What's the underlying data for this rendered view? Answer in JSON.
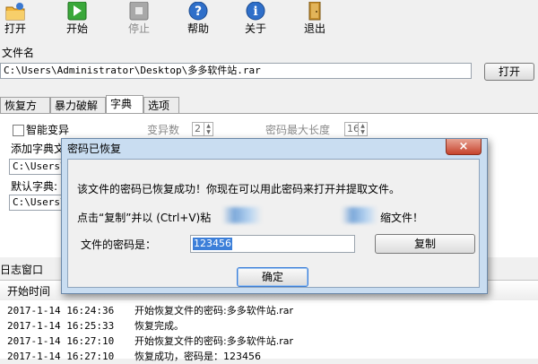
{
  "toolbar": {
    "open": "打开",
    "start": "开始",
    "stop": "停止",
    "help": "帮助",
    "about": "关于",
    "exit": "退出"
  },
  "file": {
    "label": "文件名",
    "path": "C:\\Users\\Administrator\\Desktop\\多多软件站.rar",
    "open_button": "打开"
  },
  "tabs": [
    "恢复方式",
    "暴力破解",
    "字典",
    "选项"
  ],
  "dict": {
    "smart_mutation": "智能变异",
    "mutation_count_label": "变异数",
    "mutation_count_value": "2",
    "max_length_label": "密码最大长度",
    "max_length_value": "16",
    "add_dict_label": "添加字典文",
    "add_dict_path": "C:\\Users\\",
    "default_dict_label": "默认字典:",
    "default_dict_path": "C:\\Users\\"
  },
  "log": {
    "title": "日志窗口",
    "header_time": "开始时间",
    "rows": [
      {
        "time": "2017-1-14 16:24:36",
        "msg": "开始恢复文件的密码:多多软件站.rar"
      },
      {
        "time": "2017-1-14 16:25:33",
        "msg": "恢复完成。"
      },
      {
        "time": "2017-1-14 16:27:10",
        "msg": "开始恢复文件的密码:多多软件站.rar"
      },
      {
        "time": "2017-1-14 16:27:10",
        "msg": "恢复成功，密码是：123456"
      }
    ]
  },
  "dialog": {
    "title": "密码已恢复",
    "close": "×",
    "line1": "该文件的密码已恢复成功！你现在可以用此密码来打开并提取文件。",
    "line2a": "点击“复制”并以 (Ctrl+V)粘",
    "line2b": "缩文件！",
    "password_label": "文件的密码是：",
    "password_value": "123456",
    "copy_button": "复制",
    "ok_button": "确定"
  },
  "colors": {
    "accent": "#3c7fd9",
    "dialog_frame": "#c9ddf1",
    "close_red": "#c6432c"
  }
}
